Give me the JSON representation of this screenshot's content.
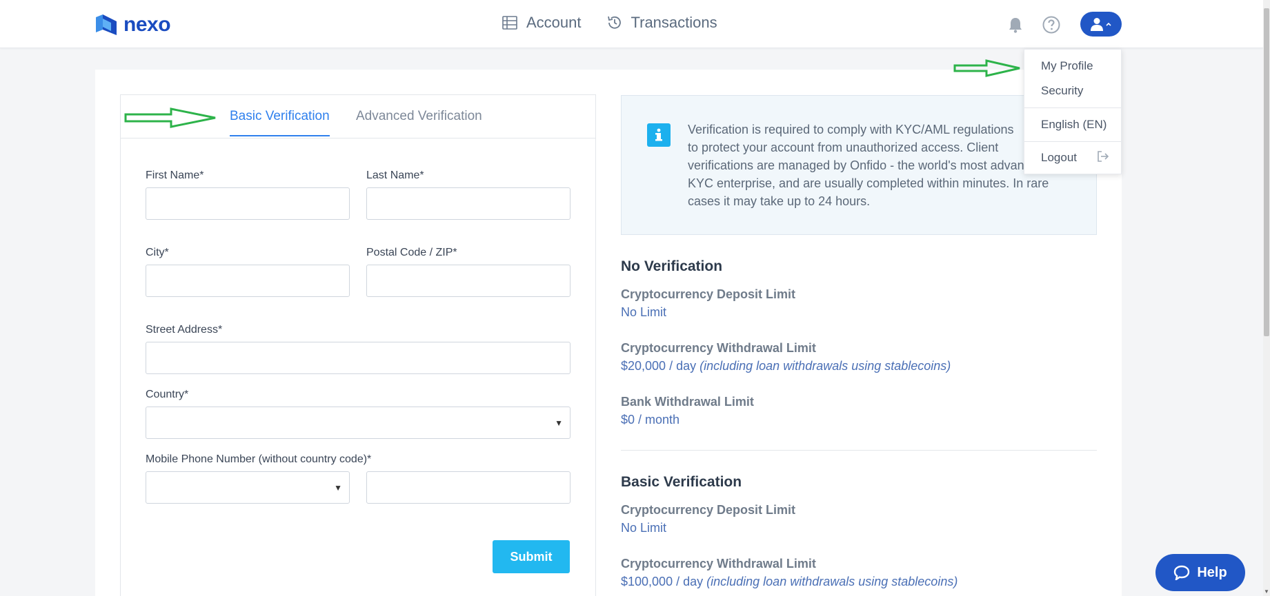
{
  "header": {
    "logo_text": "nexo",
    "nav": [
      {
        "label": "Account",
        "icon": "table-icon"
      },
      {
        "label": "Transactions",
        "icon": "history-icon"
      }
    ]
  },
  "user_menu": {
    "items": [
      "My Profile",
      "Security",
      "English (EN)",
      "Logout"
    ]
  },
  "form": {
    "tabs": [
      "Basic Verification",
      "Advanced Verification"
    ],
    "active_tab": "Basic Verification",
    "first_name_label": "First Name*",
    "last_name_label": "Last Name*",
    "city_label": "City*",
    "postal_label": "Postal Code / ZIP*",
    "street_label": "Street Address*",
    "country_label": "Country*",
    "phone_label": "Mobile Phone Number (without country code)*",
    "submit_label": "Submit"
  },
  "info": {
    "text": "Verification is required to comply with KYC/AML regulations\nto protect your account from unauthorized access. Client\nverifications are managed by Onfido - the world's most advanced\nKYC enterprise, and are usually completed within minutes. In rare\ncases it may take up to 24 hours."
  },
  "no_verification": {
    "title": "No Verification",
    "deposit_label": "Cryptocurrency Deposit Limit",
    "deposit_value": "No Limit",
    "withdrawal_label": "Cryptocurrency Withdrawal Limit",
    "withdrawal_value": "$20,000 / day",
    "withdrawal_note": "(including loan withdrawals using stablecoins)",
    "bank_label": "Bank Withdrawal Limit",
    "bank_value": "$0 / month"
  },
  "basic_verification": {
    "title": "Basic Verification",
    "deposit_label": "Cryptocurrency Deposit Limit",
    "deposit_value": "No Limit",
    "withdrawal_label": "Cryptocurrency Withdrawal Limit",
    "withdrawal_value": "$100,000 / day",
    "withdrawal_note": "(including loan withdrawals using stablecoins)"
  },
  "help_widget": {
    "label": "Help"
  },
  "colors": {
    "brand": "#2157c6",
    "accent": "#22b8f0",
    "tab_active": "#2f80ed",
    "annotation_arrow": "#2db34a"
  }
}
